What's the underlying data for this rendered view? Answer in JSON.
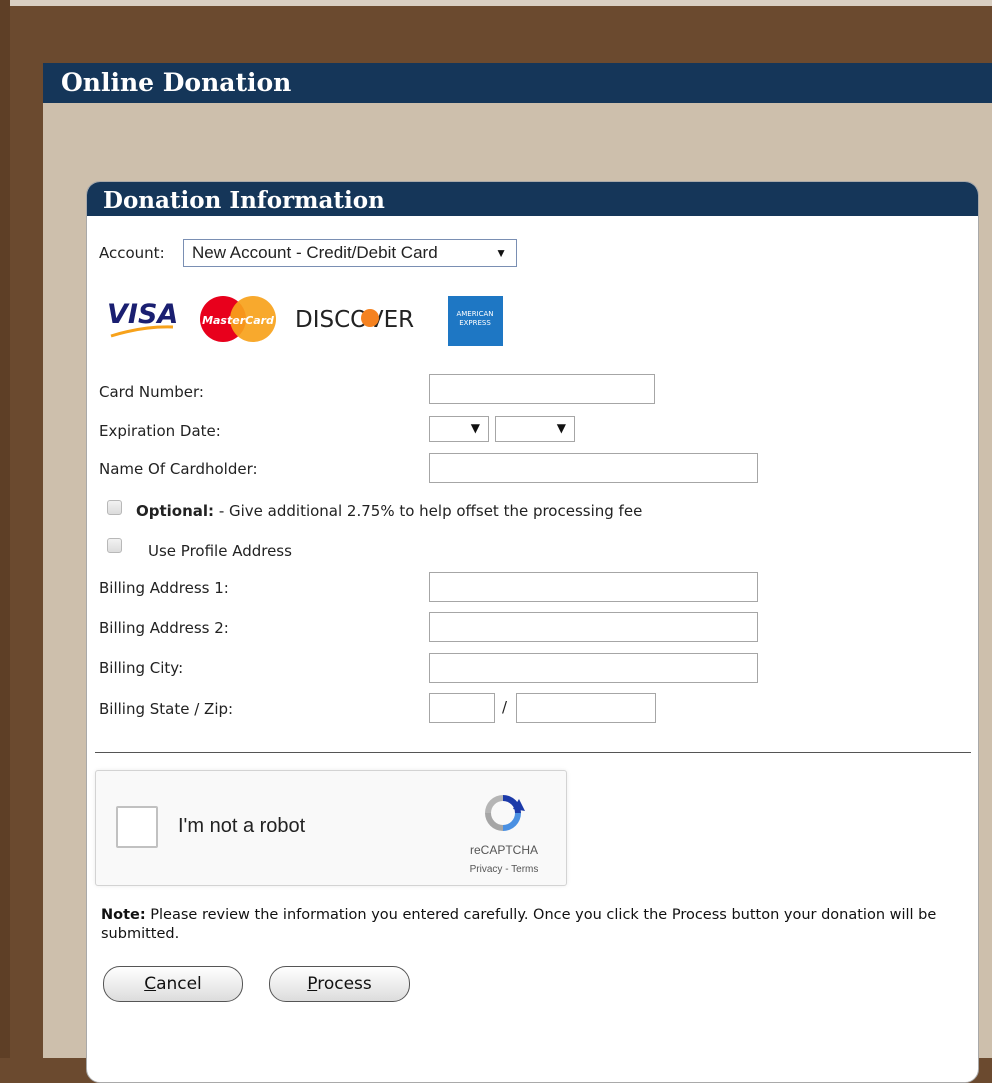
{
  "page_header": {
    "title": "Online Donation"
  },
  "panel": {
    "title": "Donation Information"
  },
  "account": {
    "label": "Account:",
    "selected": "New Account - Credit/Debit Card"
  },
  "cards": {
    "visa": "VISA",
    "mastercard": "MasterCard",
    "discover": "DISCOVER",
    "amex_line1": "AMERICAN",
    "amex_line2": "EXPRESS"
  },
  "fields": {
    "card_number": {
      "label": "Card Number:",
      "value": ""
    },
    "expiration": {
      "label": "Expiration Date:",
      "month": "",
      "year": ""
    },
    "cardholder": {
      "label": "Name Of Cardholder:",
      "value": ""
    },
    "billing_address1": {
      "label": "Billing Address 1:",
      "value": ""
    },
    "billing_address2": {
      "label": "Billing Address 2:",
      "value": ""
    },
    "billing_city": {
      "label": "Billing City:",
      "value": ""
    },
    "billing_state_zip": {
      "label": "Billing State / Zip:",
      "separator": "/",
      "state": "",
      "zip": ""
    }
  },
  "optional_fee": {
    "bold": "Optional:",
    "text": " - Give additional 2.75% to help offset the processing fee"
  },
  "use_profile": {
    "label": "Use Profile Address"
  },
  "captcha": {
    "label": "I'm not a robot",
    "brand": "reCAPTCHA",
    "links": "Privacy - Terms"
  },
  "note": {
    "bold": "Note:",
    "text": " Please review the information you entered carefully. Once you click the Process button your donation will be submitted."
  },
  "buttons": {
    "cancel_first": "C",
    "cancel_rest": "ancel",
    "process_first": "P",
    "process_rest": "rocess"
  },
  "colors": {
    "header_bg": "#153659",
    "page_bg": "#cdbfac",
    "frame_bg": "#6b4a2f"
  }
}
